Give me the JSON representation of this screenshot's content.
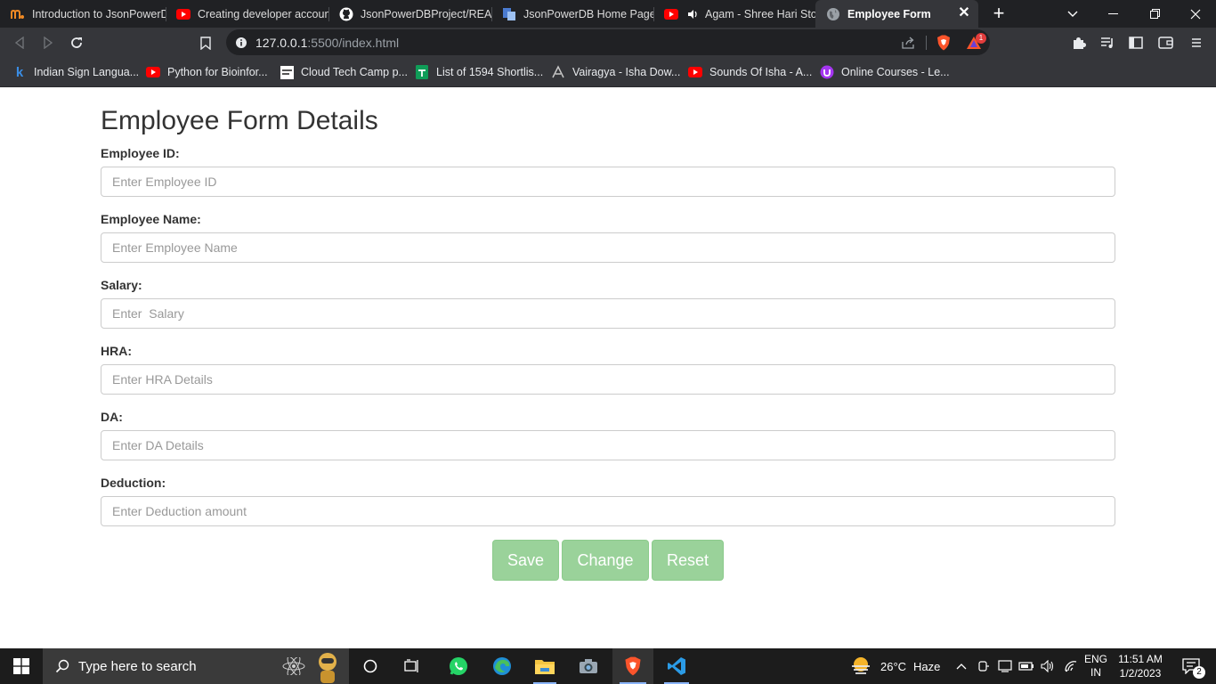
{
  "browser": {
    "tabs": [
      {
        "title": "Introduction to JsonPowerD",
        "icon": "m-logo-icon",
        "active": false
      },
      {
        "title": "Creating developer account",
        "icon": "youtube-icon",
        "active": false
      },
      {
        "title": "JsonPowerDBProject/READ",
        "icon": "github-icon",
        "active": false
      },
      {
        "title": "JsonPowerDB Home Page",
        "icon": "jpdb-icon",
        "active": false
      },
      {
        "title": "Agam - Shree Hari Stot",
        "icon": "youtube-icon",
        "active": false
      },
      {
        "title": "Employee Form",
        "icon": "globe-icon",
        "active": true
      }
    ],
    "address": {
      "host": "127.0.0.1",
      "rest": ":5500/index.html"
    },
    "brave_badge": "1",
    "bookmarks": [
      {
        "label": "Indian Sign Langua...",
        "icon": "k-icon"
      },
      {
        "label": "Python for Bioinfor...",
        "icon": "youtube-icon"
      },
      {
        "label": "Cloud Tech Camp p...",
        "icon": "page-icon"
      },
      {
        "label": "List of 1594 Shortlis...",
        "icon": "sheets-icon"
      },
      {
        "label": "Vairagya - Isha Dow...",
        "icon": "isha-icon"
      },
      {
        "label": "Sounds Of Isha - A...",
        "icon": "youtube-icon"
      },
      {
        "label": "Online Courses - Le...",
        "icon": "udemy-icon"
      }
    ]
  },
  "form": {
    "title": "Employee Form Details",
    "fields": [
      {
        "label": "Employee ID:",
        "placeholder": "Enter Employee ID",
        "value": ""
      },
      {
        "label": "Employee Name:",
        "placeholder": "Enter Employee Name",
        "value": ""
      },
      {
        "label": "Salary:",
        "placeholder": "Enter  Salary",
        "value": ""
      },
      {
        "label": "HRA:",
        "placeholder": "Enter HRA Details",
        "value": ""
      },
      {
        "label": "DA:",
        "placeholder": "Enter DA Details",
        "value": ""
      },
      {
        "label": "Deduction:",
        "placeholder": "Enter Deduction amount",
        "value": ""
      }
    ],
    "buttons": {
      "save": "Save",
      "change": "Change",
      "reset": "Reset"
    },
    "button_color": "#9ad29a"
  },
  "taskbar": {
    "search_placeholder": "Type here to search",
    "weather": {
      "temp": "26°C",
      "condition": "Haze"
    },
    "language": {
      "line1": "ENG",
      "line2": "IN"
    },
    "time": "11:51 AM",
    "date": "1/2/2023",
    "notification_count": "2"
  }
}
